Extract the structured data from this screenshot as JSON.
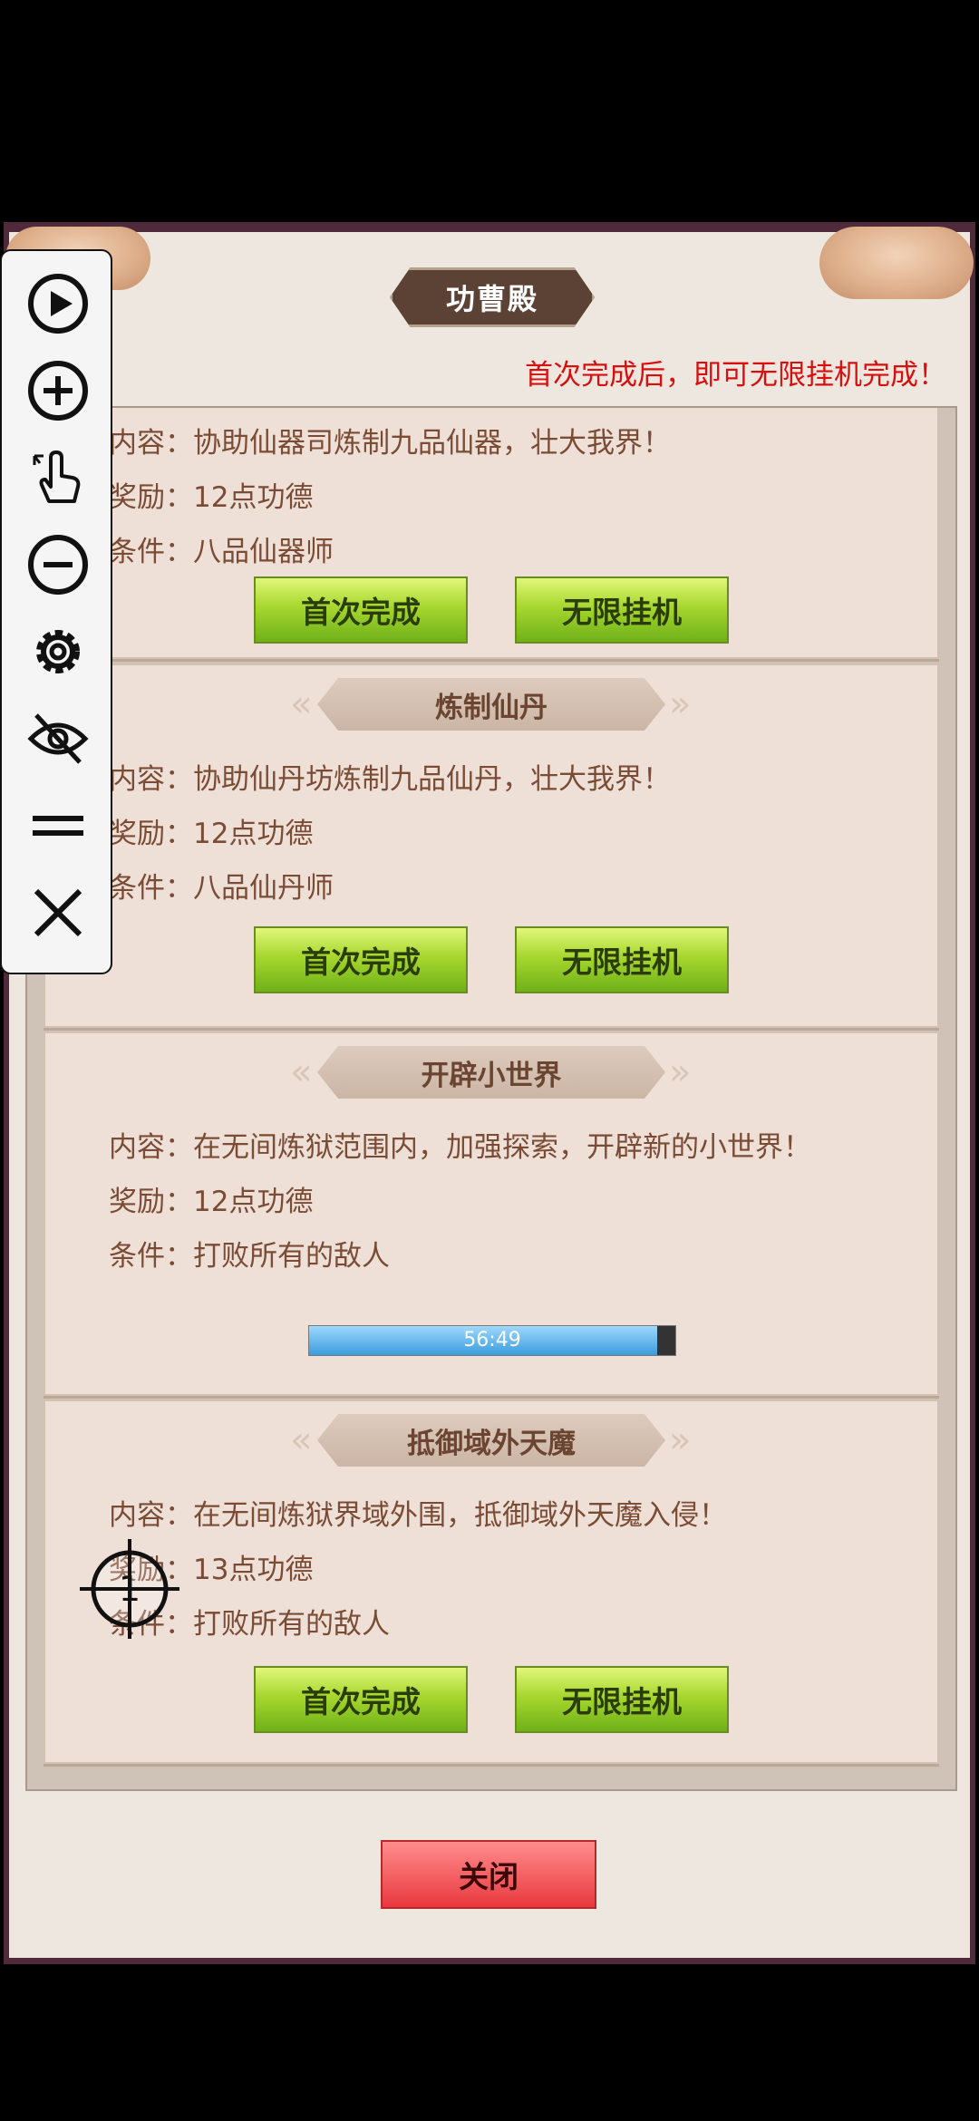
{
  "dialog": {
    "title": "功曹殿",
    "notice": "首次完成后，即可无限挂机完成！",
    "close_label": "关闭"
  },
  "cards": [
    {
      "title": "",
      "content": "内容：协助仙器司炼制九品仙器，壮大我界！",
      "reward": "奖励：12点功德",
      "condition": "条件：八品仙器师",
      "first_btn": "首次完成",
      "idle_btn": "无限挂机"
    },
    {
      "title": "炼制仙丹",
      "content": "内容：协助仙丹坊炼制九品仙丹，壮大我界！",
      "reward": "奖励：12点功德",
      "condition": "条件：八品仙丹师",
      "first_btn": "首次完成",
      "idle_btn": "无限挂机"
    },
    {
      "title": "开辟小世界",
      "content": "内容：在无间炼狱范围内，加强探索，开辟新的小世界！",
      "reward": "奖励：12点功德",
      "condition": "条件：打败所有的敌人",
      "progress_text": "56:49",
      "progress_fraction": 0.95
    },
    {
      "title": "抵御域外天魔",
      "content": "内容：在无间炼狱界域外围，抵御域外天魔入侵！",
      "reward": "奖励：13点功德",
      "condition": "条件：打败所有的敌人",
      "first_btn": "首次完成",
      "idle_btn": "无限挂机"
    }
  ],
  "toolbar": {
    "icons": [
      "play-icon",
      "zoom-in-icon",
      "tap-hand-icon",
      "zoom-out-icon",
      "gear-icon",
      "hide-eye-icon",
      "menu-lines-icon",
      "close-icon"
    ]
  },
  "crosshair_label": "1",
  "colors": {
    "accent_green": "#a7d72e",
    "notice_red": "#d90f0f",
    "close_red": "#e8393f",
    "text_brown": "#7a4b35"
  }
}
